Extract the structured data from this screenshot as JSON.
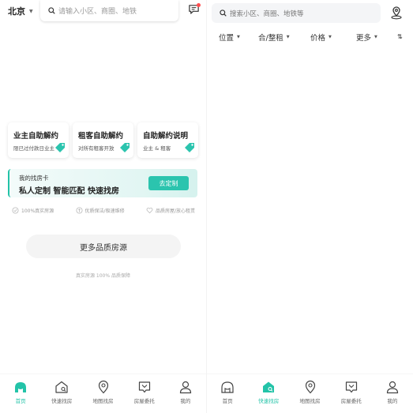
{
  "left": {
    "city": "北京",
    "search_placeholder": "请输入小区、商圈、地铁",
    "cards": [
      {
        "title": "业主自助解约",
        "subtitle": "限已过付款日业主"
      },
      {
        "title": "租客自助解约",
        "subtitle": "对所有租客开放"
      },
      {
        "title": "自助解约说明",
        "subtitle": "业主 & 租客"
      }
    ],
    "banner": {
      "line1": "我的找房卡",
      "line2": "私人定制 智能匹配 快速找房",
      "cta": "去定制"
    },
    "features": [
      "100%真实房源",
      "优质保洁/极速维修",
      "品质房屋/放心租赁"
    ],
    "more_button": "更多品质房源",
    "note": "真实房源 100% 品质保障",
    "nav": [
      {
        "label": "首页",
        "icon": "home-icon",
        "active": true
      },
      {
        "label": "快速找房",
        "icon": "house-search-icon",
        "active": false
      },
      {
        "label": "地图找房",
        "icon": "map-pin-icon",
        "active": false
      },
      {
        "label": "房屋委托",
        "icon": "entrust-icon",
        "active": false
      },
      {
        "label": "我的",
        "icon": "user-icon",
        "active": false
      }
    ]
  },
  "right": {
    "search_placeholder": "搜索小区、商圈、地铁等",
    "filters": [
      "位置",
      "合/整租",
      "价格",
      "更多"
    ],
    "nav": [
      {
        "label": "首页",
        "icon": "home-icon",
        "active": false
      },
      {
        "label": "快速找房",
        "icon": "house-search-icon",
        "active": true
      },
      {
        "label": "地图找房",
        "icon": "map-pin-icon",
        "active": false
      },
      {
        "label": "房屋委托",
        "icon": "entrust-icon",
        "active": false
      },
      {
        "label": "我的",
        "icon": "user-icon",
        "active": false
      }
    ]
  },
  "colors": {
    "accent": "#23c3a8",
    "text": "#222222",
    "muted": "#999999",
    "badge": "#ff4d4f"
  }
}
